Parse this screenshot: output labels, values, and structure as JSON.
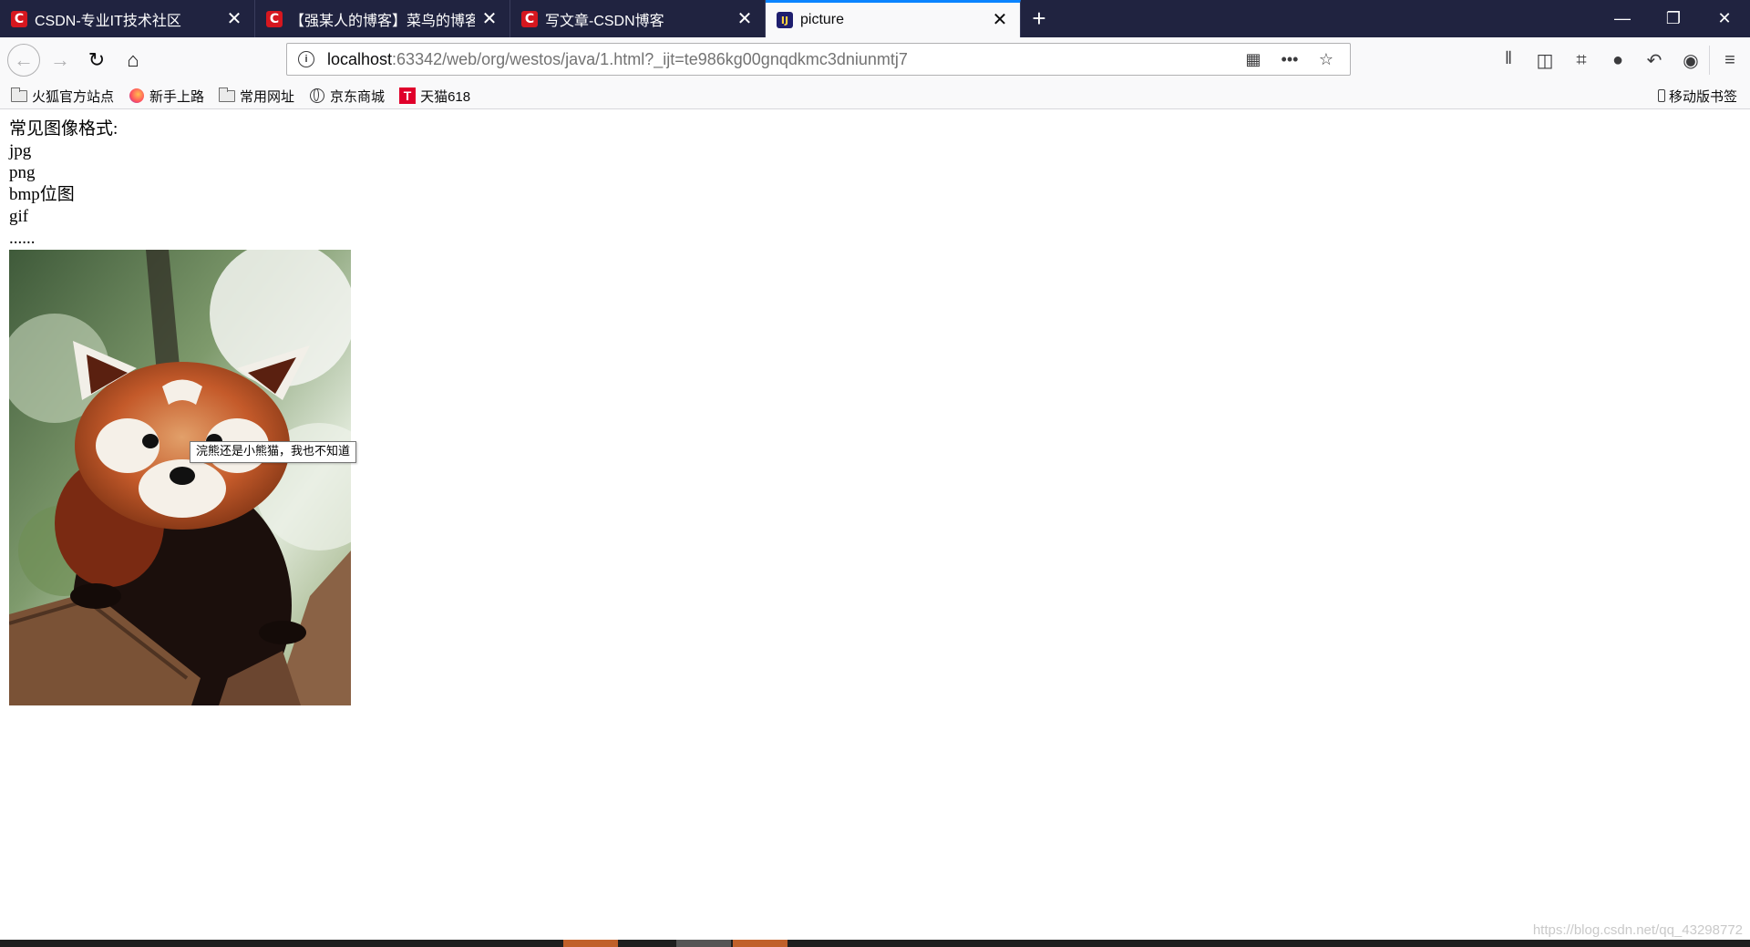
{
  "tabs": [
    {
      "title": "CSDN-专业IT技术社区",
      "icon": "csdn-favicon",
      "icon_glyph": "C",
      "active": false
    },
    {
      "title": "【强某人的博客】菜鸟的博客 -",
      "icon": "csdn-favicon",
      "icon_glyph": "C",
      "active": false
    },
    {
      "title": "写文章-CSDN博客",
      "icon": "csdn-favicon",
      "icon_glyph": "C",
      "active": false
    },
    {
      "title": "picture",
      "icon": "intellij-favicon",
      "icon_glyph": "IJ",
      "active": true
    }
  ],
  "address": {
    "host": "localhost",
    "rest": ":63342/web/org/westos/java/1.html?_ijt=te986kg00gnqdkmc3dniunmtj7"
  },
  "bookmarks": [
    {
      "label": "火狐官方站点",
      "icon": "folder-icon"
    },
    {
      "label": "新手上路",
      "icon": "firefox-icon"
    },
    {
      "label": "常用网址",
      "icon": "folder-icon"
    },
    {
      "label": "京东商城",
      "icon": "globe-icon"
    },
    {
      "label": "天猫618",
      "icon": "tmall-icon",
      "glyph": "T"
    }
  ],
  "mobile_bookmarks": "移动版书签",
  "page": {
    "lines": [
      "常见图像格式:",
      "jpg",
      "png",
      "bmp位图",
      "gif",
      "......"
    ],
    "image_tooltip": "浣熊还是小熊猫，我也不知道"
  },
  "watermark": "https://blog.csdn.net/qq_43298772",
  "colors": {
    "tab_strip": "#202340",
    "active_tab_accent": "#0a84ff",
    "csdn_red": "#d6171f"
  }
}
